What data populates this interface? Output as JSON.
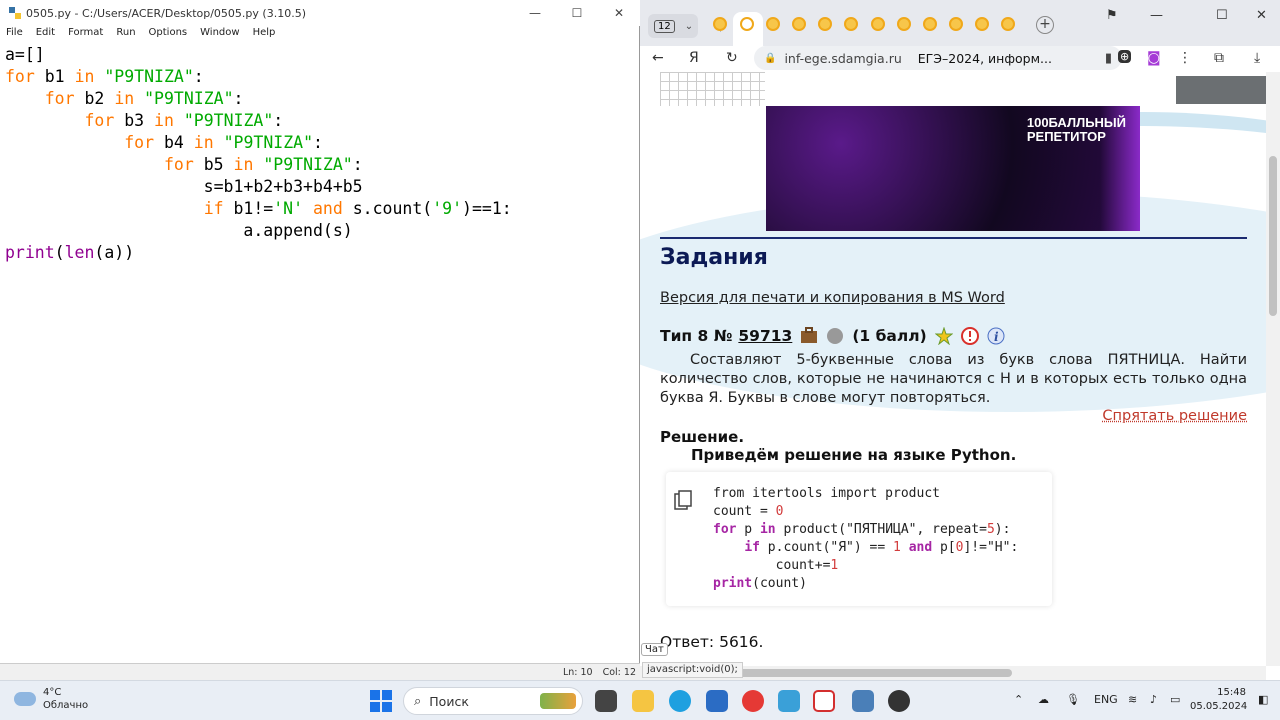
{
  "idle": {
    "title": "0505.py - C:/Users/ACER/Desktop/0505.py (3.10.5)",
    "menu": [
      "File",
      "Edit",
      "Format",
      "Run",
      "Options",
      "Window",
      "Help"
    ],
    "status_line": "Ln: 10",
    "status_col": "Col: 12",
    "code": [
      [
        {
          "t": "a=[]",
          "c": ""
        }
      ],
      [
        {
          "t": "for",
          "c": "kw"
        },
        {
          "t": " b1 ",
          "c": ""
        },
        {
          "t": "in",
          "c": "kw"
        },
        {
          "t": " ",
          "c": ""
        },
        {
          "t": "\"P9TNIZA\"",
          "c": "st"
        },
        {
          "t": ":",
          "c": ""
        }
      ],
      [
        {
          "t": "    ",
          "c": ""
        },
        {
          "t": "for",
          "c": "kw"
        },
        {
          "t": " b2 ",
          "c": ""
        },
        {
          "t": "in",
          "c": "kw"
        },
        {
          "t": " ",
          "c": ""
        },
        {
          "t": "\"P9TNIZA\"",
          "c": "st"
        },
        {
          "t": ":",
          "c": ""
        }
      ],
      [
        {
          "t": "        ",
          "c": ""
        },
        {
          "t": "for",
          "c": "kw"
        },
        {
          "t": " b3 ",
          "c": ""
        },
        {
          "t": "in",
          "c": "kw"
        },
        {
          "t": " ",
          "c": ""
        },
        {
          "t": "\"P9TNIZA\"",
          "c": "st"
        },
        {
          "t": ":",
          "c": ""
        }
      ],
      [
        {
          "t": "            ",
          "c": ""
        },
        {
          "t": "for",
          "c": "kw"
        },
        {
          "t": " b4 ",
          "c": ""
        },
        {
          "t": "in",
          "c": "kw"
        },
        {
          "t": " ",
          "c": ""
        },
        {
          "t": "\"P9TNIZA\"",
          "c": "st"
        },
        {
          "t": ":",
          "c": ""
        }
      ],
      [
        {
          "t": "                ",
          "c": ""
        },
        {
          "t": "for",
          "c": "kw"
        },
        {
          "t": " b5 ",
          "c": ""
        },
        {
          "t": "in",
          "c": "kw"
        },
        {
          "t": " ",
          "c": ""
        },
        {
          "t": "\"P9TNIZA\"",
          "c": "st"
        },
        {
          "t": ":",
          "c": ""
        }
      ],
      [
        {
          "t": "                    s=b1+b2+b3+b4+b5",
          "c": ""
        }
      ],
      [
        {
          "t": "                    ",
          "c": ""
        },
        {
          "t": "if",
          "c": "kw"
        },
        {
          "t": " b1!=",
          "c": ""
        },
        {
          "t": "'N'",
          "c": "st"
        },
        {
          "t": " ",
          "c": ""
        },
        {
          "t": "and",
          "c": "kw"
        },
        {
          "t": " s.count(",
          "c": ""
        },
        {
          "t": "'9'",
          "c": "st"
        },
        {
          "t": ")==1:",
          "c": ""
        }
      ],
      [
        {
          "t": "                        a.append(s)",
          "c": ""
        }
      ],
      [
        {
          "t": "print",
          "c": "bi"
        },
        {
          "t": "(",
          "c": ""
        },
        {
          "t": "len",
          "c": "bi"
        },
        {
          "t": "(a))",
          "c": ""
        }
      ]
    ]
  },
  "browser": {
    "tab_count": "12",
    "url_domain": "inf-ege.sdamgia.ru",
    "page_title": "ЕГЭ–2024, информ...",
    "ad_text_line1": "100БАЛЛЬНЫЙ",
    "ad_text_line2": "РЕПЕТИТОР",
    "heading": "Задания",
    "print_link": "Версия для печати и копирования в MS Word",
    "task_type": "Тип 8 №",
    "task_number": "59713",
    "task_points": "(1 балл)",
    "task_text": "Составляют 5-буквенные слова из букв слова ПЯТНИЦА. Найти количество слов, которые не начинаются с Н и в которых есть только одна буква Я. Буквы в слове могут повторяться.",
    "hide_solution": "Спрятать решение",
    "solution_label": "Решение.",
    "solution_intro": "Приведём решение на языке Python.",
    "answer": "Ответ: 5616.",
    "chat_badge": "Чат",
    "status_url": "javascript:void(0);"
  },
  "taskbar": {
    "temperature": "4°C",
    "weather": "Облачно",
    "search_placeholder": "Поиск",
    "lang": "ENG",
    "time": "15:48",
    "date": "05.05.2024"
  },
  "colors": {
    "idle_keyword": "#ff7700",
    "idle_string": "#00aa00",
    "idle_builtin": "#900090",
    "heading": "#0c1a55",
    "hide_link": "#c0392b"
  }
}
